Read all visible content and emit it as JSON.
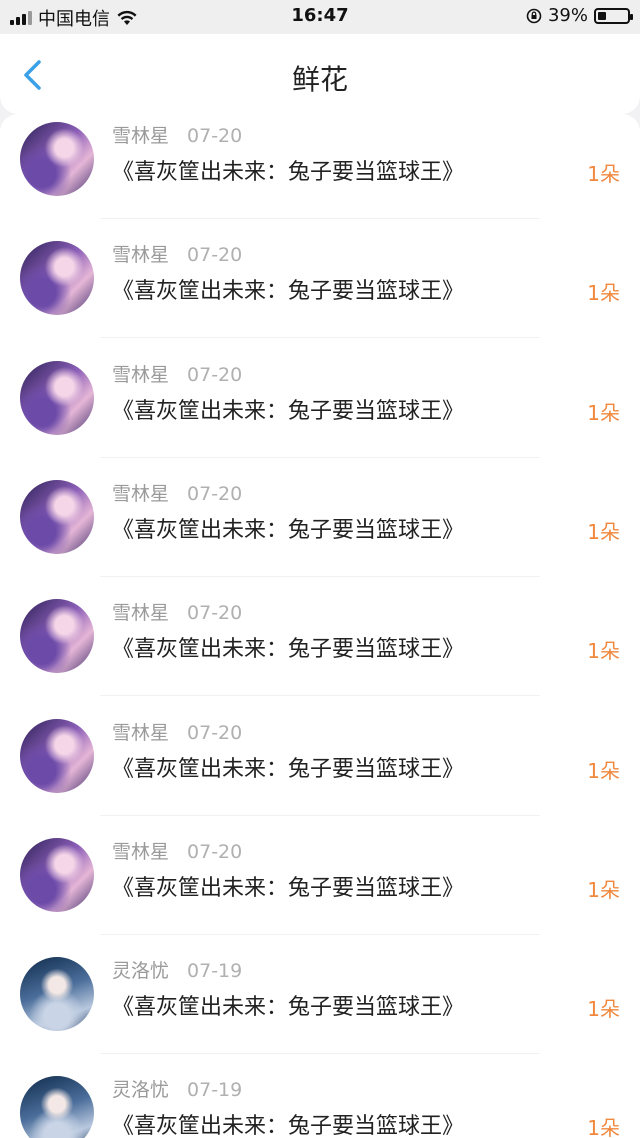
{
  "status_bar": {
    "carrier": "中国电信",
    "time": "16:47",
    "battery_text": "39%",
    "battery_level": 0.39
  },
  "nav": {
    "title": "鲜花",
    "back_icon": "chevron-left-icon"
  },
  "colors": {
    "accent": "#3aa0e8",
    "count": "#f0883e"
  },
  "list": {
    "items": [
      {
        "user": "雪林星",
        "date": "07-20",
        "book": "《喜灰筐出未来：兔子要当篮球王》",
        "count": "1朵",
        "avatar": "purple"
      },
      {
        "user": "雪林星",
        "date": "07-20",
        "book": "《喜灰筐出未来：兔子要当篮球王》",
        "count": "1朵",
        "avatar": "purple"
      },
      {
        "user": "雪林星",
        "date": "07-20",
        "book": "《喜灰筐出未来：兔子要当篮球王》",
        "count": "1朵",
        "avatar": "purple"
      },
      {
        "user": "雪林星",
        "date": "07-20",
        "book": "《喜灰筐出未来：兔子要当篮球王》",
        "count": "1朵",
        "avatar": "purple"
      },
      {
        "user": "雪林星",
        "date": "07-20",
        "book": "《喜灰筐出未来：兔子要当篮球王》",
        "count": "1朵",
        "avatar": "purple"
      },
      {
        "user": "雪林星",
        "date": "07-20",
        "book": "《喜灰筐出未来：兔子要当篮球王》",
        "count": "1朵",
        "avatar": "purple"
      },
      {
        "user": "雪林星",
        "date": "07-20",
        "book": "《喜灰筐出未来：兔子要当篮球王》",
        "count": "1朵",
        "avatar": "purple"
      },
      {
        "user": "灵洛忧",
        "date": "07-19",
        "book": "《喜灰筐出未来：兔子要当篮球王》",
        "count": "1朵",
        "avatar": "blue"
      },
      {
        "user": "灵洛忧",
        "date": "07-19",
        "book": "《喜灰筐出未来：兔子要当篮球王》",
        "count": "1朵",
        "avatar": "blue"
      }
    ]
  }
}
